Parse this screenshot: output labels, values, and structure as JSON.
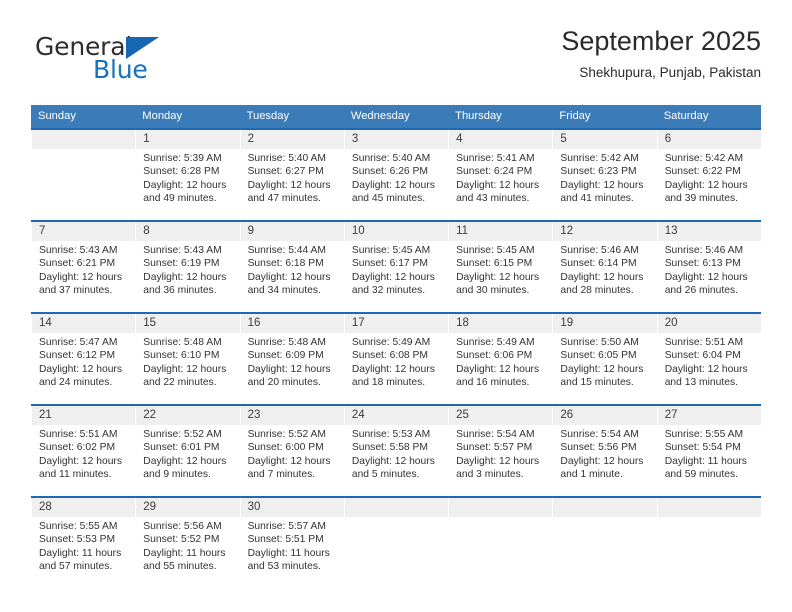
{
  "brand": {
    "word_one": "General",
    "word_two": "Blue",
    "triangle_color": "#1667b2",
    "blue_text_color": "#1772c0"
  },
  "header": {
    "title": "September 2025",
    "subtitle": "Shekhupura, Punjab, Pakistan"
  },
  "colors": {
    "header_row_bg": "#3b7cb8",
    "week_rule": "#1f69b0",
    "daynum_bg": "#efefef",
    "text": "#333333"
  },
  "weekday_headers": [
    "Sunday",
    "Monday",
    "Tuesday",
    "Wednesday",
    "Thursday",
    "Friday",
    "Saturday"
  ],
  "labels": {
    "sunrise": "Sunrise:",
    "sunset": "Sunset:",
    "daylight": "Daylight:"
  },
  "weeks": [
    [
      {
        "day": "",
        "sunrise": "",
        "sunset": "",
        "daylight_1": "",
        "daylight_2": ""
      },
      {
        "day": "1",
        "sunrise": "Sunrise: 5:39 AM",
        "sunset": "Sunset: 6:28 PM",
        "daylight_1": "Daylight: 12 hours",
        "daylight_2": "and 49 minutes."
      },
      {
        "day": "2",
        "sunrise": "Sunrise: 5:40 AM",
        "sunset": "Sunset: 6:27 PM",
        "daylight_1": "Daylight: 12 hours",
        "daylight_2": "and 47 minutes."
      },
      {
        "day": "3",
        "sunrise": "Sunrise: 5:40 AM",
        "sunset": "Sunset: 6:26 PM",
        "daylight_1": "Daylight: 12 hours",
        "daylight_2": "and 45 minutes."
      },
      {
        "day": "4",
        "sunrise": "Sunrise: 5:41 AM",
        "sunset": "Sunset: 6:24 PM",
        "daylight_1": "Daylight: 12 hours",
        "daylight_2": "and 43 minutes."
      },
      {
        "day": "5",
        "sunrise": "Sunrise: 5:42 AM",
        "sunset": "Sunset: 6:23 PM",
        "daylight_1": "Daylight: 12 hours",
        "daylight_2": "and 41 minutes."
      },
      {
        "day": "6",
        "sunrise": "Sunrise: 5:42 AM",
        "sunset": "Sunset: 6:22 PM",
        "daylight_1": "Daylight: 12 hours",
        "daylight_2": "and 39 minutes."
      }
    ],
    [
      {
        "day": "7",
        "sunrise": "Sunrise: 5:43 AM",
        "sunset": "Sunset: 6:21 PM",
        "daylight_1": "Daylight: 12 hours",
        "daylight_2": "and 37 minutes."
      },
      {
        "day": "8",
        "sunrise": "Sunrise: 5:43 AM",
        "sunset": "Sunset: 6:19 PM",
        "daylight_1": "Daylight: 12 hours",
        "daylight_2": "and 36 minutes."
      },
      {
        "day": "9",
        "sunrise": "Sunrise: 5:44 AM",
        "sunset": "Sunset: 6:18 PM",
        "daylight_1": "Daylight: 12 hours",
        "daylight_2": "and 34 minutes."
      },
      {
        "day": "10",
        "sunrise": "Sunrise: 5:45 AM",
        "sunset": "Sunset: 6:17 PM",
        "daylight_1": "Daylight: 12 hours",
        "daylight_2": "and 32 minutes."
      },
      {
        "day": "11",
        "sunrise": "Sunrise: 5:45 AM",
        "sunset": "Sunset: 6:15 PM",
        "daylight_1": "Daylight: 12 hours",
        "daylight_2": "and 30 minutes."
      },
      {
        "day": "12",
        "sunrise": "Sunrise: 5:46 AM",
        "sunset": "Sunset: 6:14 PM",
        "daylight_1": "Daylight: 12 hours",
        "daylight_2": "and 28 minutes."
      },
      {
        "day": "13",
        "sunrise": "Sunrise: 5:46 AM",
        "sunset": "Sunset: 6:13 PM",
        "daylight_1": "Daylight: 12 hours",
        "daylight_2": "and 26 minutes."
      }
    ],
    [
      {
        "day": "14",
        "sunrise": "Sunrise: 5:47 AM",
        "sunset": "Sunset: 6:12 PM",
        "daylight_1": "Daylight: 12 hours",
        "daylight_2": "and 24 minutes."
      },
      {
        "day": "15",
        "sunrise": "Sunrise: 5:48 AM",
        "sunset": "Sunset: 6:10 PM",
        "daylight_1": "Daylight: 12 hours",
        "daylight_2": "and 22 minutes."
      },
      {
        "day": "16",
        "sunrise": "Sunrise: 5:48 AM",
        "sunset": "Sunset: 6:09 PM",
        "daylight_1": "Daylight: 12 hours",
        "daylight_2": "and 20 minutes."
      },
      {
        "day": "17",
        "sunrise": "Sunrise: 5:49 AM",
        "sunset": "Sunset: 6:08 PM",
        "daylight_1": "Daylight: 12 hours",
        "daylight_2": "and 18 minutes."
      },
      {
        "day": "18",
        "sunrise": "Sunrise: 5:49 AM",
        "sunset": "Sunset: 6:06 PM",
        "daylight_1": "Daylight: 12 hours",
        "daylight_2": "and 16 minutes."
      },
      {
        "day": "19",
        "sunrise": "Sunrise: 5:50 AM",
        "sunset": "Sunset: 6:05 PM",
        "daylight_1": "Daylight: 12 hours",
        "daylight_2": "and 15 minutes."
      },
      {
        "day": "20",
        "sunrise": "Sunrise: 5:51 AM",
        "sunset": "Sunset: 6:04 PM",
        "daylight_1": "Daylight: 12 hours",
        "daylight_2": "and 13 minutes."
      }
    ],
    [
      {
        "day": "21",
        "sunrise": "Sunrise: 5:51 AM",
        "sunset": "Sunset: 6:02 PM",
        "daylight_1": "Daylight: 12 hours",
        "daylight_2": "and 11 minutes."
      },
      {
        "day": "22",
        "sunrise": "Sunrise: 5:52 AM",
        "sunset": "Sunset: 6:01 PM",
        "daylight_1": "Daylight: 12 hours",
        "daylight_2": "and 9 minutes."
      },
      {
        "day": "23",
        "sunrise": "Sunrise: 5:52 AM",
        "sunset": "Sunset: 6:00 PM",
        "daylight_1": "Daylight: 12 hours",
        "daylight_2": "and 7 minutes."
      },
      {
        "day": "24",
        "sunrise": "Sunrise: 5:53 AM",
        "sunset": "Sunset: 5:58 PM",
        "daylight_1": "Daylight: 12 hours",
        "daylight_2": "and 5 minutes."
      },
      {
        "day": "25",
        "sunrise": "Sunrise: 5:54 AM",
        "sunset": "Sunset: 5:57 PM",
        "daylight_1": "Daylight: 12 hours",
        "daylight_2": "and 3 minutes."
      },
      {
        "day": "26",
        "sunrise": "Sunrise: 5:54 AM",
        "sunset": "Sunset: 5:56 PM",
        "daylight_1": "Daylight: 12 hours",
        "daylight_2": "and 1 minute."
      },
      {
        "day": "27",
        "sunrise": "Sunrise: 5:55 AM",
        "sunset": "Sunset: 5:54 PM",
        "daylight_1": "Daylight: 11 hours",
        "daylight_2": "and 59 minutes."
      }
    ],
    [
      {
        "day": "28",
        "sunrise": "Sunrise: 5:55 AM",
        "sunset": "Sunset: 5:53 PM",
        "daylight_1": "Daylight: 11 hours",
        "daylight_2": "and 57 minutes."
      },
      {
        "day": "29",
        "sunrise": "Sunrise: 5:56 AM",
        "sunset": "Sunset: 5:52 PM",
        "daylight_1": "Daylight: 11 hours",
        "daylight_2": "and 55 minutes."
      },
      {
        "day": "30",
        "sunrise": "Sunrise: 5:57 AM",
        "sunset": "Sunset: 5:51 PM",
        "daylight_1": "Daylight: 11 hours",
        "daylight_2": "and 53 minutes."
      },
      {
        "day": "",
        "sunrise": "",
        "sunset": "",
        "daylight_1": "",
        "daylight_2": ""
      },
      {
        "day": "",
        "sunrise": "",
        "sunset": "",
        "daylight_1": "",
        "daylight_2": ""
      },
      {
        "day": "",
        "sunrise": "",
        "sunset": "",
        "daylight_1": "",
        "daylight_2": ""
      },
      {
        "day": "",
        "sunrise": "",
        "sunset": "",
        "daylight_1": "",
        "daylight_2": ""
      }
    ]
  ]
}
